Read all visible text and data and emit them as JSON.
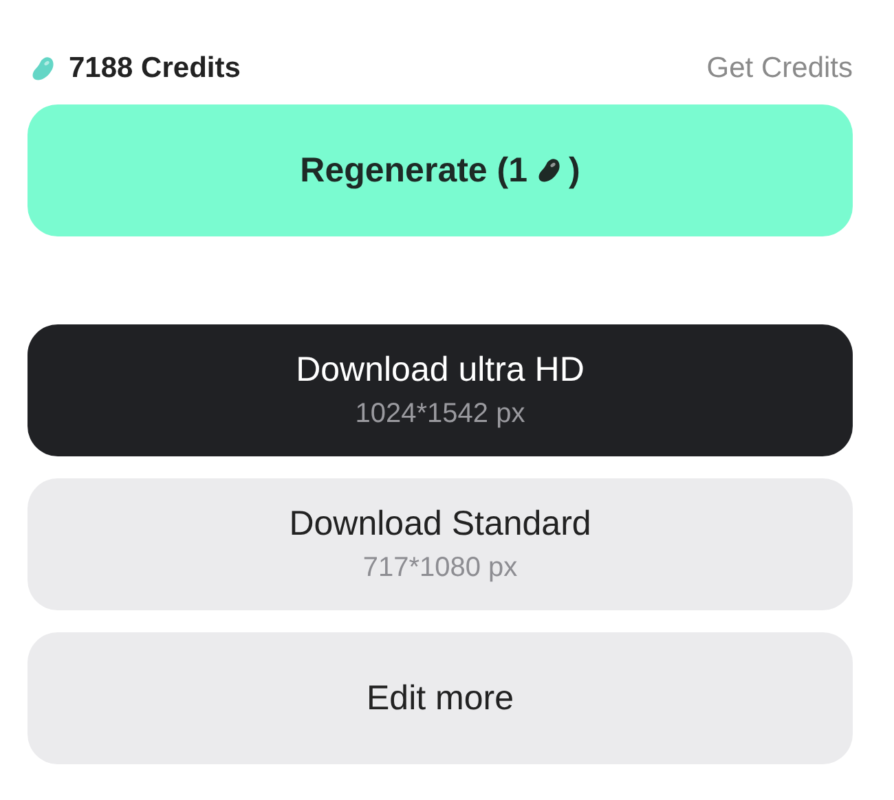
{
  "credits": {
    "amount": "7188 Credits",
    "link": "Get Credits"
  },
  "regenerate": {
    "label_before": "Regenerate (1",
    "label_after": ")"
  },
  "buttons": [
    {
      "kind": "dark",
      "label": "Download ultra HD",
      "detail": "1024*1542 px"
    },
    {
      "kind": "light",
      "label": "Download Standard",
      "detail": "717*1080 px"
    },
    {
      "kind": "light",
      "label": "Edit more"
    }
  ]
}
